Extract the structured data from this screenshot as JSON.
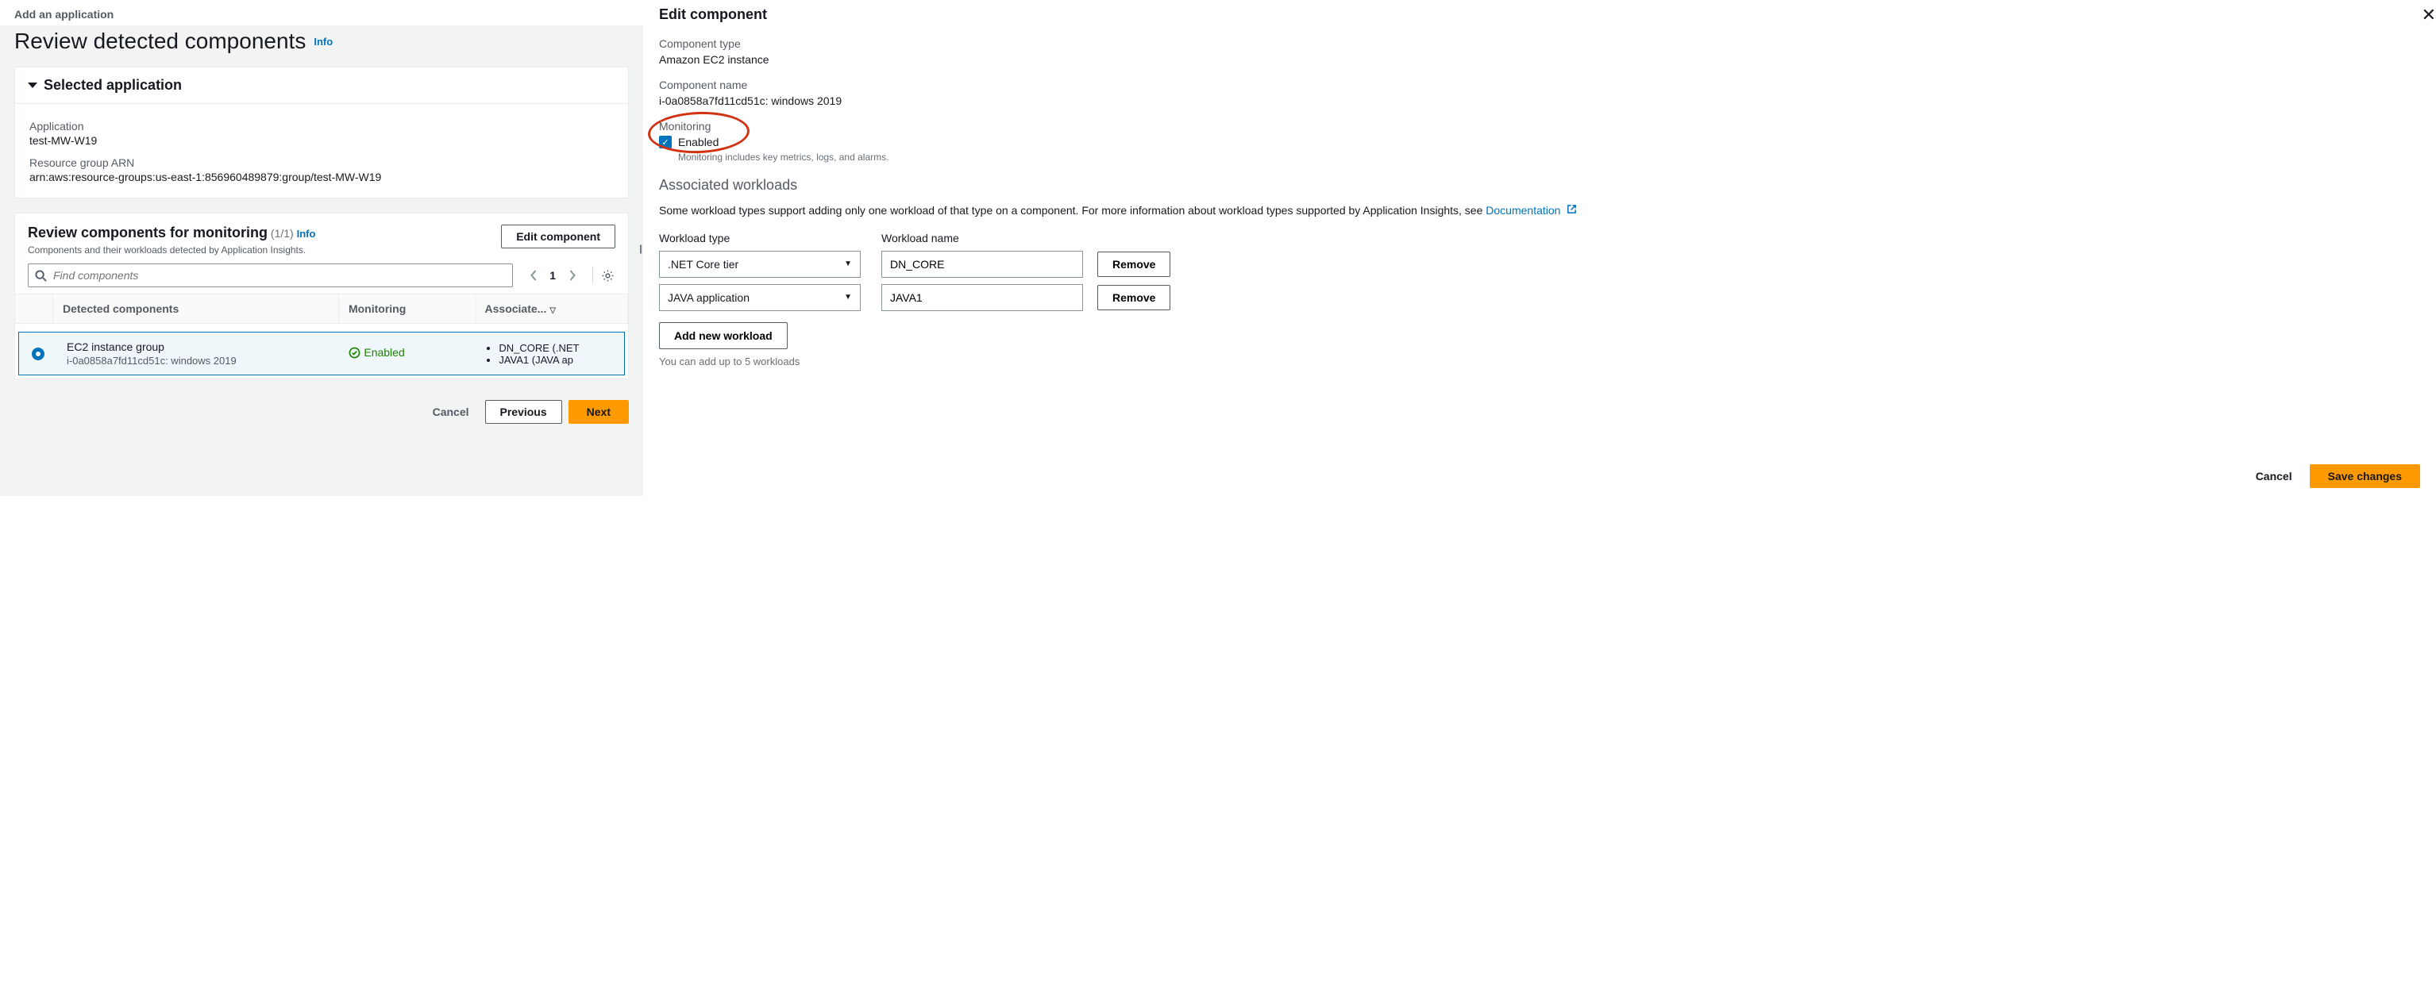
{
  "breadcrumb": "Add an application",
  "pageTitle": "Review detected components",
  "infoLabel": "Info",
  "selectedApp": {
    "panelTitle": "Selected application",
    "appLabel": "Application",
    "appValue": "test-MW-W19",
    "arnLabel": "Resource group ARN",
    "arnValue": "arn:aws:resource-groups:us-east-1:856960489879:group/test-MW-W19"
  },
  "compPanel": {
    "title": "Review components for monitoring",
    "count": "(1/1)",
    "subtext": "Components and their workloads detected by Application Insights.",
    "editBtn": "Edit component",
    "searchPlaceholder": "Find components",
    "pageNum": "1",
    "cols": {
      "comp": "Detected components",
      "mon": "Monitoring",
      "assoc": "Associate..."
    },
    "row": {
      "main": "EC2 instance group",
      "sub": "i-0a0858a7fd11cd51c: windows 2019",
      "status": "Enabled",
      "assoc": [
        "DN_CORE (.NET",
        "JAVA1 (JAVA ap"
      ]
    }
  },
  "footer": {
    "cancel": "Cancel",
    "prev": "Previous",
    "next": "Next"
  },
  "drawer": {
    "title": "Edit component",
    "typeLabel": "Component type",
    "typeValue": "Amazon EC2 instance",
    "nameLabel": "Component name",
    "nameValue": "i-0a0858a7fd11cd51c: windows 2019",
    "monLabel": "Monitoring",
    "monEnabled": "Enabled",
    "monHelp": "Monitoring includes key metrics, logs, and alarms.",
    "assocTitle": "Associated workloads",
    "assocDesc1": "Some workload types support adding only one workload of that type on a component. For more information about workload types supported by Application Insights, see ",
    "docLink": "Documentation",
    "wlTypeLabel": "Workload type",
    "wlNameLabel": "Workload name",
    "rows": [
      {
        "type": ".NET Core tier",
        "name": "DN_CORE"
      },
      {
        "type": "JAVA application",
        "name": "JAVA1"
      }
    ],
    "removeBtn": "Remove",
    "addBtn": "Add new workload",
    "addHelp": "You can add up to 5 workloads",
    "cancel": "Cancel",
    "save": "Save changes"
  }
}
